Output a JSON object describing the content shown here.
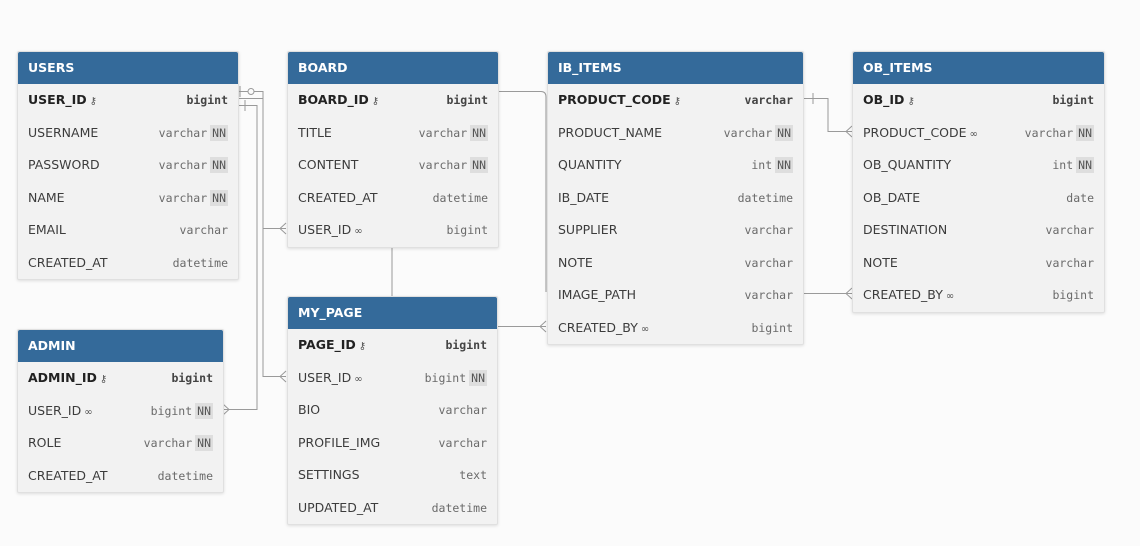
{
  "tables": [
    {
      "id": "users",
      "name": "USERS",
      "columns": [
        {
          "name": "USER_ID",
          "type": "bigint",
          "pk": true,
          "nn": false,
          "fk": false
        },
        {
          "name": "USERNAME",
          "type": "varchar",
          "pk": false,
          "nn": true,
          "fk": false
        },
        {
          "name": "PASSWORD",
          "type": "varchar",
          "pk": false,
          "nn": true,
          "fk": false
        },
        {
          "name": "NAME",
          "type": "varchar",
          "pk": false,
          "nn": true,
          "fk": false
        },
        {
          "name": "EMAIL",
          "type": "varchar",
          "pk": false,
          "nn": false,
          "fk": false
        },
        {
          "name": "CREATED_AT",
          "type": "datetime",
          "pk": false,
          "nn": false,
          "fk": false
        }
      ]
    },
    {
      "id": "board",
      "name": "BOARD",
      "columns": [
        {
          "name": "BOARD_ID",
          "type": "bigint",
          "pk": true,
          "nn": false,
          "fk": false
        },
        {
          "name": "TITLE",
          "type": "varchar",
          "pk": false,
          "nn": true,
          "fk": false
        },
        {
          "name": "CONTENT",
          "type": "varchar",
          "pk": false,
          "nn": true,
          "fk": false
        },
        {
          "name": "CREATED_AT",
          "type": "datetime",
          "pk": false,
          "nn": false,
          "fk": false
        },
        {
          "name": "USER_ID",
          "type": "bigint",
          "pk": false,
          "nn": false,
          "fk": true
        }
      ]
    },
    {
      "id": "ib_items",
      "name": "IB_ITEMS",
      "columns": [
        {
          "name": "PRODUCT_CODE",
          "type": "varchar",
          "pk": true,
          "nn": false,
          "fk": false
        },
        {
          "name": "PRODUCT_NAME",
          "type": "varchar",
          "pk": false,
          "nn": true,
          "fk": false
        },
        {
          "name": "QUANTITY",
          "type": "int",
          "pk": false,
          "nn": true,
          "fk": false
        },
        {
          "name": "IB_DATE",
          "type": "datetime",
          "pk": false,
          "nn": false,
          "fk": false
        },
        {
          "name": "SUPPLIER",
          "type": "varchar",
          "pk": false,
          "nn": false,
          "fk": false
        },
        {
          "name": "NOTE",
          "type": "varchar",
          "pk": false,
          "nn": false,
          "fk": false
        },
        {
          "name": "IMAGE_PATH",
          "type": "varchar",
          "pk": false,
          "nn": false,
          "fk": false
        },
        {
          "name": "CREATED_BY",
          "type": "bigint",
          "pk": false,
          "nn": false,
          "fk": true
        }
      ]
    },
    {
      "id": "ob_items",
      "name": "OB_ITEMS",
      "columns": [
        {
          "name": "OB_ID",
          "type": "bigint",
          "pk": true,
          "nn": false,
          "fk": false
        },
        {
          "name": "PRODUCT_CODE",
          "type": "varchar",
          "pk": false,
          "nn": true,
          "fk": true
        },
        {
          "name": "OB_QUANTITY",
          "type": "int",
          "pk": false,
          "nn": true,
          "fk": false
        },
        {
          "name": "OB_DATE",
          "type": "date",
          "pk": false,
          "nn": false,
          "fk": false
        },
        {
          "name": "DESTINATION",
          "type": "varchar",
          "pk": false,
          "nn": false,
          "fk": false
        },
        {
          "name": "NOTE",
          "type": "varchar",
          "pk": false,
          "nn": false,
          "fk": false
        },
        {
          "name": "CREATED_BY",
          "type": "bigint",
          "pk": false,
          "nn": false,
          "fk": true
        }
      ]
    },
    {
      "id": "admin",
      "name": "ADMIN",
      "columns": [
        {
          "name": "ADMIN_ID",
          "type": "bigint",
          "pk": true,
          "nn": false,
          "fk": false
        },
        {
          "name": "USER_ID",
          "type": "bigint",
          "pk": false,
          "nn": true,
          "fk": true
        },
        {
          "name": "ROLE",
          "type": "varchar",
          "pk": false,
          "nn": true,
          "fk": false
        },
        {
          "name": "CREATED_AT",
          "type": "datetime",
          "pk": false,
          "nn": false,
          "fk": false
        }
      ]
    },
    {
      "id": "my_page",
      "name": "MY_PAGE",
      "columns": [
        {
          "name": "PAGE_ID",
          "type": "bigint",
          "pk": true,
          "nn": false,
          "fk": false
        },
        {
          "name": "USER_ID",
          "type": "bigint",
          "pk": false,
          "nn": true,
          "fk": true
        },
        {
          "name": "BIO",
          "type": "varchar",
          "pk": false,
          "nn": false,
          "fk": false
        },
        {
          "name": "PROFILE_IMG",
          "type": "varchar",
          "pk": false,
          "nn": false,
          "fk": false
        },
        {
          "name": "SETTINGS",
          "type": "text",
          "pk": false,
          "nn": false,
          "fk": false
        },
        {
          "name": "UPDATED_AT",
          "type": "datetime",
          "pk": false,
          "nn": false,
          "fk": false
        }
      ]
    }
  ],
  "nn_label": "NN",
  "icons": {
    "primary_key": "key-icon",
    "foreign_key": "link-icon"
  },
  "colors": {
    "header": "#346a9a",
    "body": "#f2f2f2",
    "line": "#9a9a9a",
    "badge": "#dedede"
  }
}
